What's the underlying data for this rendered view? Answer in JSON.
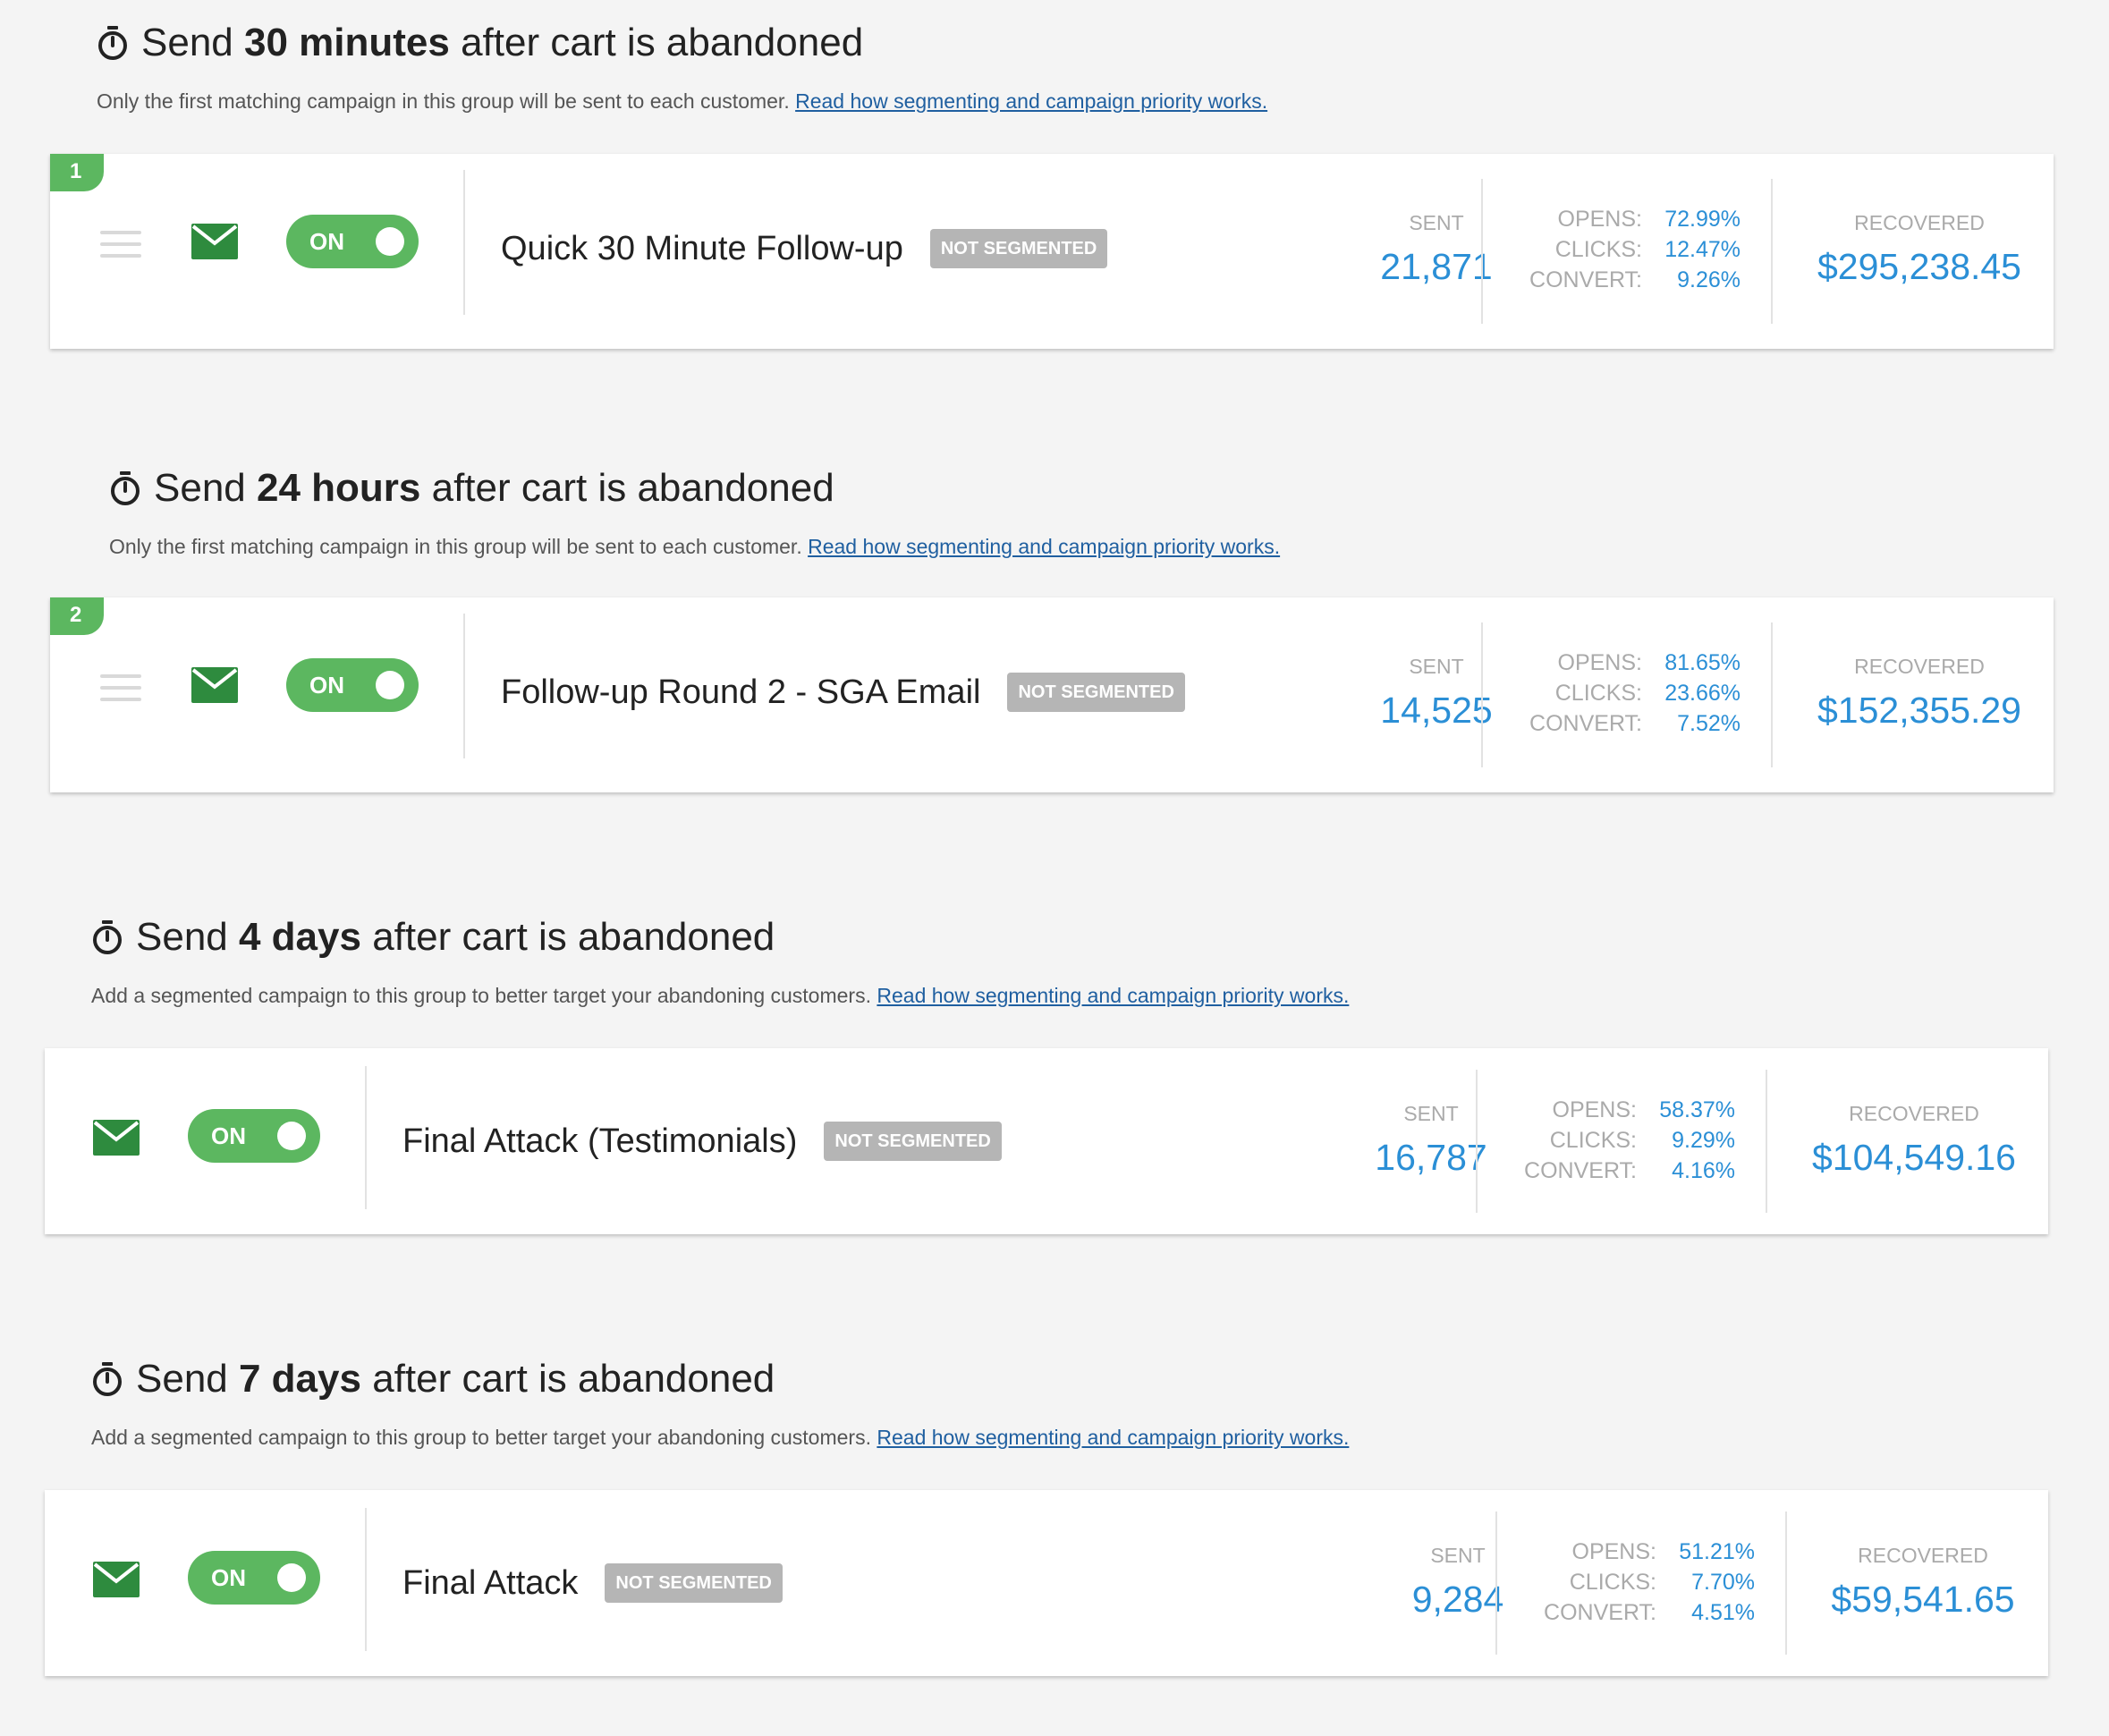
{
  "groups": [
    {
      "title_prefix": "Send ",
      "title_bold": "30 minutes",
      "title_suffix": " after cart is abandoned",
      "subtitle": "Only the first matching campaign in this group will be sent to each customer.",
      "link": "Read how segmenting and campaign priority works.",
      "campaign": {
        "priority": "1",
        "toggle": "ON",
        "name": "Quick 30 Minute Follow-up",
        "badge": "NOT SEGMENTED",
        "sent_label": "SENT",
        "sent": "21,871",
        "opens_label": "OPENS:",
        "opens": "72.99%",
        "clicks_label": "CLICKS:",
        "clicks": "12.47%",
        "convert_label": "CONVERT:",
        "convert": "9.26%",
        "recovered_label": "RECOVERED",
        "recovered": "$295,238.45"
      }
    },
    {
      "title_prefix": "Send ",
      "title_bold": "24 hours",
      "title_suffix": " after cart is abandoned",
      "subtitle": "Only the first matching campaign in this group will be sent to each customer.",
      "link": "Read how segmenting and campaign priority works.",
      "campaign": {
        "priority": "2",
        "toggle": "ON",
        "name": "Follow-up Round 2 - SGA Email",
        "badge": "NOT SEGMENTED",
        "sent_label": "SENT",
        "sent": "14,525",
        "opens_label": "OPENS:",
        "opens": "81.65%",
        "clicks_label": "CLICKS:",
        "clicks": "23.66%",
        "convert_label": "CONVERT:",
        "convert": "7.52%",
        "recovered_label": "RECOVERED",
        "recovered": "$152,355.29"
      }
    },
    {
      "title_prefix": "Send ",
      "title_bold": "4 days",
      "title_suffix": " after cart is abandoned",
      "subtitle": "Add a segmented campaign to this group to better target your abandoning customers.",
      "link": "Read how segmenting and campaign priority works.",
      "campaign": {
        "toggle": "ON",
        "name": "Final Attack (Testimonials)",
        "badge": "NOT SEGMENTED",
        "sent_label": "SENT",
        "sent": "16,787",
        "opens_label": "OPENS:",
        "opens": "58.37%",
        "clicks_label": "CLICKS:",
        "clicks": "9.29%",
        "convert_label": "CONVERT:",
        "convert": "4.16%",
        "recovered_label": "RECOVERED",
        "recovered": "$104,549.16"
      }
    },
    {
      "title_prefix": "Send ",
      "title_bold": "7 days",
      "title_suffix": " after cart is abandoned",
      "subtitle": "Add a segmented campaign to this group to better target your abandoning customers.",
      "link": "Read how segmenting and campaign priority works.",
      "campaign": {
        "toggle": "ON",
        "name": "Final Attack",
        "badge": "NOT SEGMENTED",
        "sent_label": "SENT",
        "sent": "9,284",
        "opens_label": "OPENS:",
        "opens": "51.21%",
        "clicks_label": "CLICKS:",
        "clicks": "7.70%",
        "convert_label": "CONVERT:",
        "convert": "4.51%",
        "recovered_label": "RECOVERED",
        "recovered": "$59,541.65"
      }
    }
  ],
  "colors": {
    "accent_green": "#5cb760",
    "icon_green": "#2e8b3e",
    "value_blue": "#2b8fd6",
    "link_blue": "#1f5fa0",
    "badge_gray": "#b5b5b5",
    "page_bg": "#f4f4f4"
  },
  "icons": {
    "timer": "stopwatch-icon",
    "mail": "envelope-icon",
    "drag": "drag-handle-icon"
  }
}
